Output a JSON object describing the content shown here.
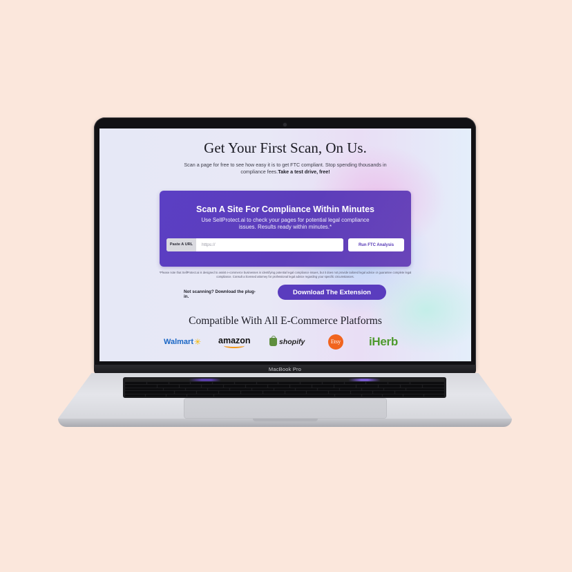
{
  "laptop": {
    "model_label": "MacBook Pro"
  },
  "page": {
    "headline": "Get Your First Scan, On Us.",
    "subtext": "Scan a page for free to see how easy it is to get FTC compliant. Stop spending thousands in compliance fees.",
    "subtext_bold": "Take a test drive, free!",
    "card": {
      "title": "Scan A Site For Compliance Within Minutes",
      "description": "Use SellProtect.ai to check your pages for potential legal compliance issues. Results ready within minutes.*",
      "url_label": "Paste A URL",
      "url_placeholder": "https://",
      "url_value": "",
      "run_button": "Run FTC Analysis"
    },
    "disclaimer": "*Please note that SellProtect.ai is designed to assist e-commerce businesses in identifying potential legal compliance issues, but it does not provide tailored legal advice or guarantee complete legal compliance. Consult a licensed attorney for professional legal advice regarding your specific circumstances.",
    "plugin_text": "Not scanning? Download the plug-in.",
    "download_button": "Download The Extension",
    "compat_heading": "Compatible With All E-Commerce Platforms",
    "platforms": [
      {
        "name": "Walmart",
        "icon": "walmart-spark-icon"
      },
      {
        "name": "amazon",
        "icon": "amazon-smile-icon"
      },
      {
        "name": "shopify",
        "icon": "shopify-bag-icon"
      },
      {
        "name": "Etsy",
        "icon": "etsy-circle-icon"
      },
      {
        "name": "iHerb",
        "icon": "iherb-wordmark"
      }
    ]
  },
  "colors": {
    "background": "#fbe7dc",
    "card_purple": "#5b3fc4",
    "button_purple": "#5a3cbe",
    "walmart_blue": "#1a66c4",
    "walmart_yellow": "#f5b800",
    "amazon_orange": "#f39a1c",
    "shopify_green": "#5e8e3e",
    "etsy_orange": "#f1641e",
    "iherb_green": "#4e9a2e"
  }
}
